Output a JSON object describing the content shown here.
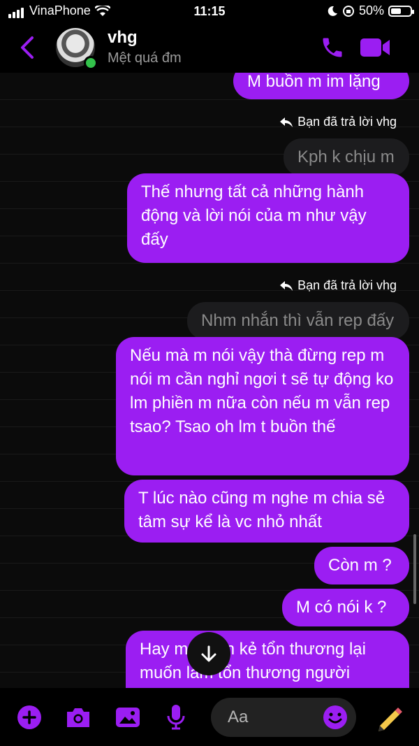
{
  "status_bar": {
    "carrier": "VinaPhone",
    "time": "11:15",
    "battery": "50%"
  },
  "header": {
    "name": "vhg",
    "status": "Mệt quá đm"
  },
  "messages": [
    {
      "text": "M buồn m im lặng"
    },
    {
      "note": "Bạn đã trả lời vhg"
    },
    {
      "text": "Kph k chịu m"
    },
    {
      "text": "Thế nhưng tất cả những hành động và lời nói của m như vậy đấy"
    },
    {
      "note": "Bạn đã trả lời vhg"
    },
    {
      "text": "Nhm nhắn thì vẫn rep đấy"
    },
    {
      "text": "Nếu mà m nói vậy thà đừng rep m nói m cần nghỉ ngơi t sẽ tự động ko lm phiền m nữa còn nếu m vẫn rep tsao? Tsao oh lm t buồn thế"
    },
    {
      "text": "T lúc nào cũng m nghe m chia sẻ tâm sự kể là vc nhỏ nhất"
    },
    {
      "text": "Còn m ?"
    },
    {
      "text": "M có nói k ?"
    },
    {
      "text": "Hay m muốn kẻ tổn thương lại muốn làm tổn thương người"
    }
  ],
  "composer": {
    "placeholder": "Aa"
  },
  "colors": {
    "accent": "#9b1ef2",
    "background": "#000000"
  },
  "icons": [
    "back-icon",
    "phone-icon",
    "video-icon",
    "plus-icon",
    "camera-icon",
    "gallery-icon",
    "mic-icon",
    "emoji-icon",
    "pencil-icon",
    "scroll-down-icon",
    "reply-icon"
  ]
}
